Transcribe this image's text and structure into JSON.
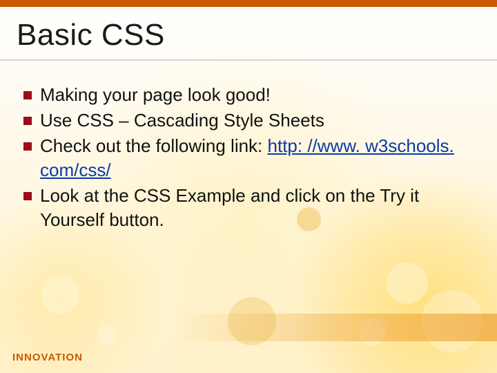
{
  "title": "Basic CSS",
  "bullets": [
    {
      "text": "Making your page look good!"
    },
    {
      "text": "Use CSS – Cascading Style Sheets"
    },
    {
      "text_before": "Check out the following link: ",
      "link": "http: //www. w3schools. com/css/"
    },
    {
      "text": "Look at the CSS Example and click on the Try it Yourself button."
    }
  ],
  "brand": "INNOVATION",
  "colors": {
    "accent": "#c85a00",
    "bullet": "#9a0c1a",
    "link": "#0a3aa5"
  }
}
